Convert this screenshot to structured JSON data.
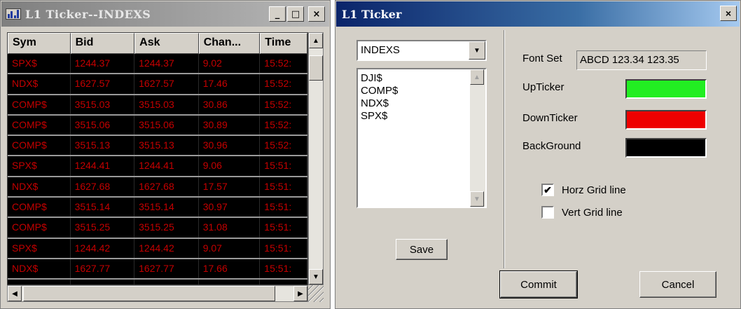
{
  "left_window": {
    "title": "L1 Ticker--INDEXS",
    "minimize": "_",
    "maximize": "□",
    "close": "×",
    "columns": [
      "Sym",
      "Bid",
      "Ask",
      "Chan...",
      "Time"
    ],
    "rows": [
      [
        "SPX$",
        "1244.37",
        "1244.37",
        "9.02",
        "15:52:"
      ],
      [
        "NDX$",
        "1627.57",
        "1627.57",
        "17.46",
        "15:52:"
      ],
      [
        "COMP$",
        "3515.03",
        "3515.03",
        "30.86",
        "15:52:"
      ],
      [
        "COMP$",
        "3515.06",
        "3515.06",
        "30.89",
        "15:52:"
      ],
      [
        "COMP$",
        "3515.13",
        "3515.13",
        "30.96",
        "15:52:"
      ],
      [
        "SPX$",
        "1244.41",
        "1244.41",
        "9.06",
        "15:51:"
      ],
      [
        "NDX$",
        "1627.68",
        "1627.68",
        "17.57",
        "15:51:"
      ],
      [
        "COMP$",
        "3515.14",
        "3515.14",
        "30.97",
        "15:51:"
      ],
      [
        "COMP$",
        "3515.25",
        "3515.25",
        "31.08",
        "15:51:"
      ],
      [
        "SPX$",
        "1244.42",
        "1244.42",
        "9.07",
        "15:51:"
      ],
      [
        "NDX$",
        "1627.77",
        "1627.77",
        "17.66",
        "15:51:"
      ],
      [
        "",
        "",
        "",
        "",
        ""
      ]
    ],
    "colors": {
      "text": "#c40000",
      "background": "#000000"
    }
  },
  "settings_dialog": {
    "title": "L1 Ticker",
    "close": "×",
    "list_select": "INDEXS",
    "symbols": [
      "DJI$",
      "COMP$",
      "NDX$",
      "SPX$"
    ],
    "save_label": "Save",
    "font_set_label": "Font Set",
    "font_set_sample": "ABCD 123.34 123.35",
    "up_ticker_label": "UpTicker",
    "up_ticker_color": "#22ee22",
    "down_ticker_label": "DownTicker",
    "down_ticker_color": "#ee0000",
    "background_label": "BackGround",
    "background_color": "#000000",
    "horz_grid_label": "Horz Grid line",
    "horz_grid_checked": true,
    "vert_grid_label": "Vert Grid line",
    "vert_grid_checked": false,
    "commit_label": "Commit",
    "cancel_label": "Cancel"
  }
}
